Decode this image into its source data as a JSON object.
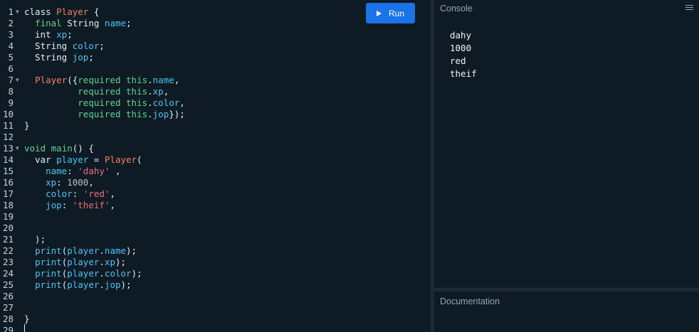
{
  "toolbar": {
    "run_label": "Run",
    "run_icon": "play-icon"
  },
  "console": {
    "title": "Console",
    "menu_icon": "clear-console-icon",
    "output": [
      "dahy",
      "1000",
      "red",
      "theif"
    ]
  },
  "documentation": {
    "title": "Documentation"
  },
  "editor": {
    "lines": [
      {
        "n": "1",
        "fold": true,
        "tokens": [
          [
            "kw",
            "class "
          ],
          [
            "cls",
            "Player"
          ],
          [
            "pl",
            " {"
          ]
        ]
      },
      {
        "n": "2",
        "tokens": [
          [
            "pl",
            "  "
          ],
          [
            "req",
            "final"
          ],
          [
            "pl",
            " String "
          ],
          [
            "var",
            "name"
          ],
          [
            "pl",
            ";"
          ]
        ]
      },
      {
        "n": "3",
        "tokens": [
          [
            "pl",
            "  int "
          ],
          [
            "var",
            "xp"
          ],
          [
            "pl",
            ";"
          ]
        ]
      },
      {
        "n": "4",
        "tokens": [
          [
            "pl",
            "  String "
          ],
          [
            "var",
            "color"
          ],
          [
            "pl",
            ";"
          ]
        ]
      },
      {
        "n": "5",
        "tokens": [
          [
            "pl",
            "  String "
          ],
          [
            "var",
            "jop"
          ],
          [
            "pl",
            ";"
          ]
        ]
      },
      {
        "n": "6",
        "tokens": []
      },
      {
        "n": "7",
        "fold": true,
        "tokens": [
          [
            "pl",
            "  "
          ],
          [
            "cls",
            "Player"
          ],
          [
            "pl",
            "({"
          ],
          [
            "req",
            "required this"
          ],
          [
            "pl",
            "."
          ],
          [
            "var",
            "name"
          ],
          [
            "pl",
            ","
          ]
        ]
      },
      {
        "n": "8",
        "tokens": [
          [
            "pl",
            "          "
          ],
          [
            "req",
            "required this"
          ],
          [
            "pl",
            "."
          ],
          [
            "var",
            "xp"
          ],
          [
            "pl",
            ","
          ]
        ]
      },
      {
        "n": "9",
        "tokens": [
          [
            "pl",
            "          "
          ],
          [
            "req",
            "required this"
          ],
          [
            "pl",
            "."
          ],
          [
            "var",
            "color"
          ],
          [
            "pl",
            ","
          ]
        ]
      },
      {
        "n": "10",
        "tokens": [
          [
            "pl",
            "          "
          ],
          [
            "req",
            "required this"
          ],
          [
            "pl",
            "."
          ],
          [
            "var",
            "jop"
          ],
          [
            "pl",
            "});"
          ]
        ]
      },
      {
        "n": "11",
        "tokens": [
          [
            "pl",
            "}"
          ]
        ]
      },
      {
        "n": "12",
        "tokens": []
      },
      {
        "n": "13",
        "fold": true,
        "tokens": [
          [
            "req",
            "void"
          ],
          [
            "pl",
            " "
          ],
          [
            "req",
            "main"
          ],
          [
            "pl",
            "() {"
          ]
        ]
      },
      {
        "n": "14",
        "tokens": [
          [
            "pl",
            "  var "
          ],
          [
            "var",
            "player"
          ],
          [
            "pl",
            " = "
          ],
          [
            "cls",
            "Player"
          ],
          [
            "pl",
            "("
          ]
        ]
      },
      {
        "n": "15",
        "tokens": [
          [
            "pl",
            "    "
          ],
          [
            "var",
            "name"
          ],
          [
            "pl",
            ": "
          ],
          [
            "str",
            "'dahy'"
          ],
          [
            "pl",
            " ,"
          ]
        ]
      },
      {
        "n": "16",
        "tokens": [
          [
            "pl",
            "    "
          ],
          [
            "var",
            "xp"
          ],
          [
            "pl",
            ": "
          ],
          [
            "num",
            "1000"
          ],
          [
            "pl",
            ","
          ]
        ]
      },
      {
        "n": "17",
        "tokens": [
          [
            "pl",
            "    "
          ],
          [
            "var",
            "color"
          ],
          [
            "pl",
            ": "
          ],
          [
            "str",
            "'red'"
          ],
          [
            "pl",
            ","
          ]
        ]
      },
      {
        "n": "18",
        "tokens": [
          [
            "pl",
            "    "
          ],
          [
            "var",
            "jop"
          ],
          [
            "pl",
            ": "
          ],
          [
            "str",
            "'theif'"
          ],
          [
            "pl",
            ","
          ]
        ]
      },
      {
        "n": "19",
        "tokens": []
      },
      {
        "n": "20",
        "tokens": []
      },
      {
        "n": "21",
        "tokens": [
          [
            "pl",
            "  );"
          ]
        ]
      },
      {
        "n": "22",
        "tokens": [
          [
            "pl",
            "  "
          ],
          [
            "var",
            "print"
          ],
          [
            "pl",
            "("
          ],
          [
            "var",
            "player"
          ],
          [
            "pl",
            "."
          ],
          [
            "var",
            "name"
          ],
          [
            "pl",
            ");"
          ]
        ]
      },
      {
        "n": "23",
        "tokens": [
          [
            "pl",
            "  "
          ],
          [
            "var",
            "print"
          ],
          [
            "pl",
            "("
          ],
          [
            "var",
            "player"
          ],
          [
            "pl",
            "."
          ],
          [
            "var",
            "xp"
          ],
          [
            "pl",
            ");"
          ]
        ]
      },
      {
        "n": "24",
        "tokens": [
          [
            "pl",
            "  "
          ],
          [
            "var",
            "print"
          ],
          [
            "pl",
            "("
          ],
          [
            "var",
            "player"
          ],
          [
            "pl",
            "."
          ],
          [
            "var",
            "color"
          ],
          [
            "pl",
            ");"
          ]
        ]
      },
      {
        "n": "25",
        "tokens": [
          [
            "pl",
            "  "
          ],
          [
            "var",
            "print"
          ],
          [
            "pl",
            "("
          ],
          [
            "var",
            "player"
          ],
          [
            "pl",
            "."
          ],
          [
            "var",
            "jop"
          ],
          [
            "pl",
            ");"
          ]
        ]
      },
      {
        "n": "26",
        "tokens": []
      },
      {
        "n": "27",
        "tokens": []
      },
      {
        "n": "28",
        "tokens": [
          [
            "pl",
            "}"
          ]
        ]
      },
      {
        "n": "29",
        "tokens": []
      }
    ]
  }
}
